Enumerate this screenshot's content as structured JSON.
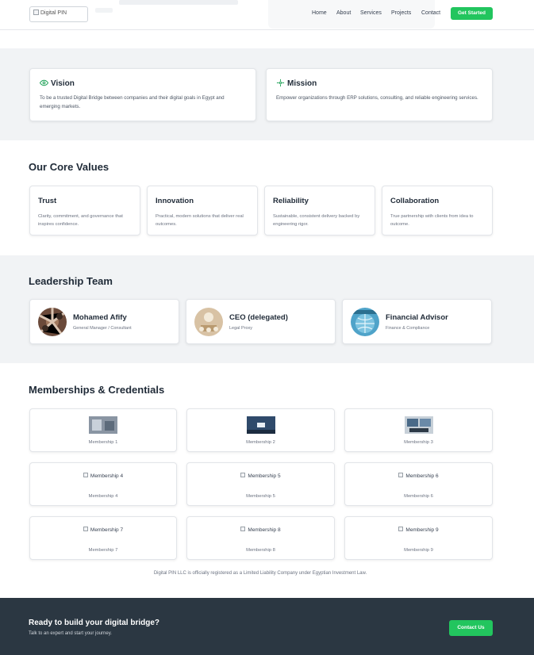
{
  "header": {
    "logo_alt": "Digital PIN",
    "nav": [
      "Home",
      "About",
      "Services",
      "Projects",
      "Contact"
    ],
    "cta_label": "Get Started"
  },
  "vision": {
    "title": "Vision",
    "icon": "eye-icon",
    "text": "To be a trusted Digital Bridge between companies and their digital goals in Egypt and emerging markets."
  },
  "mission": {
    "title": "Mission",
    "icon": "sparkle-icon",
    "text": "Empower organizations through ERP solutions, consulting, and reliable engineering services."
  },
  "core_values": {
    "heading": "Our Core Values",
    "items": [
      {
        "title": "Trust",
        "text": "Clarity, commitment, and governance that inspires confidence."
      },
      {
        "title": "Innovation",
        "text": "Practical, modern solutions that deliver real outcomes."
      },
      {
        "title": "Reliability",
        "text": "Sustainable, consistent delivery backed by engineering rigor."
      },
      {
        "title": "Collaboration",
        "text": "True partnership with clients from idea to outcome."
      }
    ]
  },
  "leadership": {
    "heading": "Leadership Team",
    "members": [
      {
        "name": "Mohamed Afify",
        "role": "General Manager / Consultant"
      },
      {
        "name": "CEO (delegated)",
        "role": "Legal Proxy"
      },
      {
        "name": "Financial Advisor",
        "role": "Finance & Compliance"
      }
    ]
  },
  "memberships": {
    "heading": "Memberships & Credentials",
    "items": [
      {
        "alt": "Membership 1",
        "caption": "Membership 1",
        "loaded": true
      },
      {
        "alt": "Membership 2",
        "caption": "Membership 2",
        "loaded": true
      },
      {
        "alt": "Membership 3",
        "caption": "Membership 3",
        "loaded": true
      },
      {
        "alt": "Membership 4",
        "caption": "Membership 4",
        "loaded": false
      },
      {
        "alt": "Membership 5",
        "caption": "Membership 5",
        "loaded": false
      },
      {
        "alt": "Membership 6",
        "caption": "Membership 6",
        "loaded": false
      },
      {
        "alt": "Membership 7",
        "caption": "Membership 7",
        "loaded": false
      },
      {
        "alt": "Membership 8",
        "caption": "Membership 8",
        "loaded": false
      },
      {
        "alt": "Membership 9",
        "caption": "Membership 9",
        "loaded": false
      }
    ],
    "legal_note": "Digital PIN LLC is officially registered as a Limited Liability Company under Egyptian Investment Law."
  },
  "cta": {
    "title": "Ready to build your digital bridge?",
    "subtitle": "Talk to an expert and start your journey.",
    "button": "Contact Us"
  },
  "colors": {
    "accent": "#22c55e",
    "footer_bg": "#2b3742",
    "band_gray": "#f1f3f5"
  }
}
